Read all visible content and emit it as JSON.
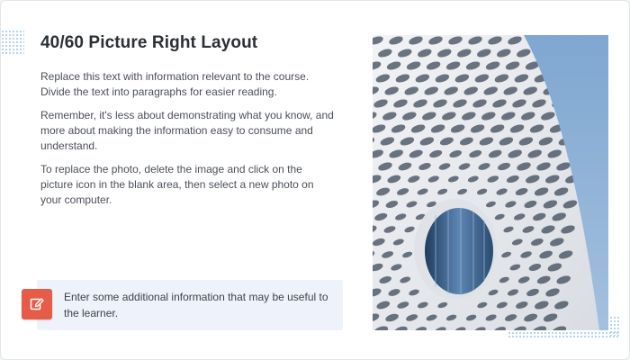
{
  "layout": {
    "title": "40/60 Picture Right Layout",
    "paragraphs": [
      "Replace this text with information relevant to the course. Divide the text into paragraphs for easier reading.",
      "Remember, it's less about demonstrating what you know, and more about making the information easy to consume and understand.",
      "To replace the photo, delete the image and click on the picture icon in the blank area, then select a new photo on your computer."
    ],
    "callout": {
      "icon": "edit-icon",
      "text": "Enter some additional information that may be useful to the learner."
    },
    "image": {
      "subject": "building-facade-photo"
    }
  },
  "colors": {
    "accent": "#e55c48",
    "callout_bg": "#eef3fb",
    "sky": "#8fb2d6"
  }
}
